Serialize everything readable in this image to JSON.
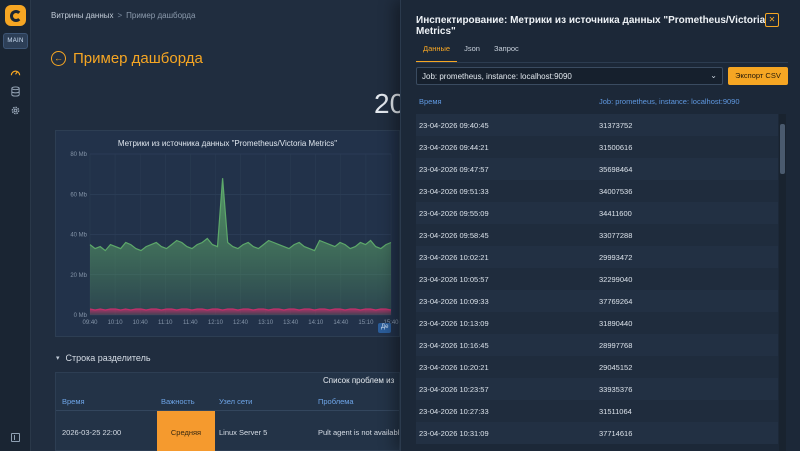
{
  "app": {
    "badge": "MAIN"
  },
  "breadcrumb": {
    "parent": "Витрины данных",
    "separator": ">",
    "current": "Пример дашборда"
  },
  "dashboard": {
    "title": "Пример дашборда",
    "big_stat": "20",
    "chart_title": "Метрики из источника данных \"Prometheus/Victoria Metrics\"",
    "legend_chip": "Дe",
    "row_separator": "Строка разделитель",
    "table_title": "Список проблем из",
    "table_headers": [
      "Время",
      "Важность",
      "Узел сети",
      "Проблема"
    ],
    "table_rows": [
      {
        "time": "2026-03-25 22:00",
        "severity": "Средняя",
        "host": "Linux Server 5",
        "problem": "Pult agent is not availabl"
      }
    ]
  },
  "chart_data": {
    "type": "area",
    "title": "Метрики из источника данных \"Prometheus/Victoria Metrics\"",
    "x_ticks": [
      "09:40",
      "10:10",
      "10:40",
      "11:10",
      "11:40",
      "12:10",
      "12:40",
      "13:10",
      "13:40",
      "14:10",
      "14:40",
      "15:10",
      "15:40"
    ],
    "y_ticks": [
      "0 Mb",
      "20 Mb",
      "40 Mb",
      "60 Mb",
      "80 Mb"
    ],
    "ylim": [
      0,
      80
    ],
    "series": [
      {
        "color": "#5da86a",
        "values": [
          35,
          33,
          34,
          32,
          35,
          34,
          33,
          36,
          35,
          33,
          32,
          34,
          35,
          36,
          34,
          33,
          35,
          37,
          36,
          34,
          33,
          35,
          36,
          38,
          35,
          34,
          68,
          36,
          34,
          33,
          35,
          36,
          34,
          33,
          35,
          37,
          36,
          35,
          34,
          33,
          35,
          36,
          34,
          33,
          32,
          37,
          36,
          35,
          34,
          36,
          35,
          33,
          34,
          36,
          35,
          37,
          34,
          33,
          35,
          36
        ]
      },
      {
        "color": "#c0306b",
        "values": [
          3,
          2.5,
          3,
          2.5,
          3,
          3,
          2.5,
          3,
          2.5,
          3,
          3,
          2.5,
          3,
          3,
          2.5,
          3,
          3,
          2.5,
          3,
          3,
          2.5,
          3,
          3,
          2.5,
          3,
          3,
          2.5,
          3,
          3,
          2.5,
          3,
          3,
          2.5,
          3,
          3,
          2.5,
          3,
          3,
          2.5,
          3,
          3,
          2.5,
          3,
          3,
          2.5,
          3,
          3,
          2.5,
          3,
          3,
          2.5,
          3,
          3,
          2.5,
          3,
          3,
          2.5,
          3,
          3,
          2.5
        ]
      }
    ]
  },
  "inspect": {
    "title": "Инспектирование: Метрики из источника данных \"Prometheus/Victoria Metrics\"",
    "close_icon": "close-icon",
    "tabs": [
      "Данные",
      "Json",
      "Запрос"
    ],
    "active_tab": "Данные",
    "select_value": "Job: prometheus, instance: localhost:9090",
    "export_label": "Экспорт CSV",
    "columns": [
      "Время",
      "Job: prometheus, instance: localhost:9090"
    ],
    "rows": [
      {
        "time": "23-04-2026 09:40:45",
        "value": "31373752"
      },
      {
        "time": "23-04-2026 09:44:21",
        "value": "31500616"
      },
      {
        "time": "23-04-2026 09:47:57",
        "value": "35698464"
      },
      {
        "time": "23-04-2026 09:51:33",
        "value": "34007536"
      },
      {
        "time": "23-04-2026 09:55:09",
        "value": "34411600"
      },
      {
        "time": "23-04-2026 09:58:45",
        "value": "33077288"
      },
      {
        "time": "23-04-2026 10:02:21",
        "value": "29993472"
      },
      {
        "time": "23-04-2026 10:05:57",
        "value": "32299040"
      },
      {
        "time": "23-04-2026 10:09:33",
        "value": "37769264"
      },
      {
        "time": "23-04-2026 10:13:09",
        "value": "31890440"
      },
      {
        "time": "23-04-2026 10:16:45",
        "value": "28997768"
      },
      {
        "time": "23-04-2026 10:20:21",
        "value": "29045152"
      },
      {
        "time": "23-04-2026 10:23:57",
        "value": "33935376"
      },
      {
        "time": "23-04-2026 10:27:33",
        "value": "31511064"
      },
      {
        "time": "23-04-2026 10:31:09",
        "value": "37714616"
      }
    ]
  }
}
